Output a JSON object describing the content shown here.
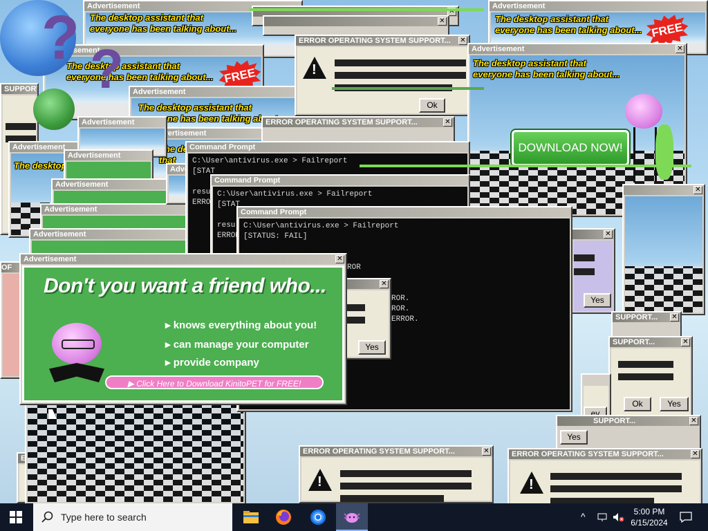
{
  "ad": {
    "title": "Advertisement",
    "slogan_line1": "The desktop assistant that",
    "slogan_line2": "everyone has been talking about...",
    "free_label": "FREE",
    "download_now": "DOWNLOAD NOW!"
  },
  "error": {
    "title": "ERROR OPERATING SYSTEM SUPPORT...",
    "title_short": "SUPPORT...",
    "ok": "Ok",
    "yes": "Yes"
  },
  "cmd": {
    "title": "Command Prompt",
    "line1": "C:\\User\\antivirus.exe > Failreport",
    "line2": "[STATUS: FAIL]",
    "frag_stat": "[STAT",
    "frag_result": "result",
    "frag_error": "ERROR",
    "frag_ror": "ROR",
    "frag_ror2": "ROR.",
    "frag_error_dot": "ERROR."
  },
  "friend": {
    "headline": "Don't you want a friend who...",
    "features": [
      "knows everything about you!",
      "can manage your computer",
      "provide company"
    ],
    "cta": "Click Here to Download KinitoPET for FREE!"
  },
  "taskbar": {
    "search_placeholder": "Type here to search",
    "time": "5:00 PM",
    "date": "6/15/2024"
  },
  "colors": {
    "ad_green": "#4caf50",
    "pink": "#f07ec4",
    "yellow": "#ffe600",
    "free_red": "#e8231d"
  }
}
